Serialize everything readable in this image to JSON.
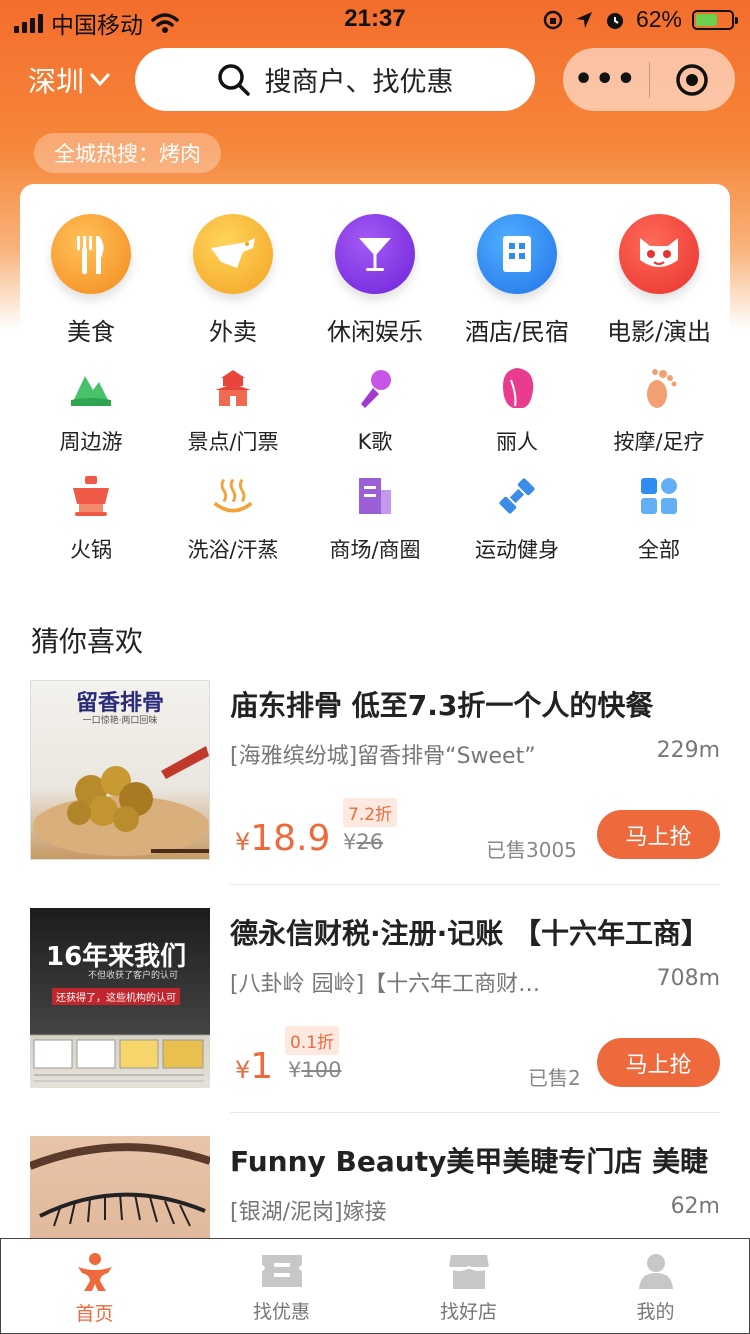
{
  "status_bar": {
    "carrier": "中国移动",
    "time": "21:37",
    "battery": "62%"
  },
  "header": {
    "city": "深圳",
    "search_placeholder": "搜商户、找优惠",
    "hot_search": "全城热搜：烤肉"
  },
  "primary_categories": [
    {
      "label": "美食",
      "icon": "cutlery-icon",
      "color": "#f7a22a"
    },
    {
      "label": "外卖",
      "icon": "kangaroo-icon",
      "color": "#f8b42a"
    },
    {
      "label": "休闲娱乐",
      "icon": "cocktail-icon",
      "color": "#8a33e6"
    },
    {
      "label": "酒店/民宿",
      "icon": "building-icon",
      "color": "#2d8df0"
    },
    {
      "label": "电影/演出",
      "icon": "cat-icon",
      "color": "#f2483f"
    }
  ],
  "secondary_categories": [
    {
      "label": "周边游",
      "icon": "mountain-icon"
    },
    {
      "label": "景点/门票",
      "icon": "temple-icon"
    },
    {
      "label": "K歌",
      "icon": "microphone-icon"
    },
    {
      "label": "丽人",
      "icon": "woman-icon"
    },
    {
      "label": "按摩/足疗",
      "icon": "footprint-icon"
    },
    {
      "label": "火锅",
      "icon": "hotpot-icon"
    },
    {
      "label": "洗浴/汗蒸",
      "icon": "hot-spring-icon"
    },
    {
      "label": "商场/商圈",
      "icon": "mall-icon"
    },
    {
      "label": "运动健身",
      "icon": "dumbbell-icon"
    },
    {
      "label": "全部",
      "icon": "grid-icon"
    }
  ],
  "section_title": "猜你喜欢",
  "deals": [
    {
      "title": "庙东排骨 低至7.3折一个人的快餐",
      "subtitle": "[海雅缤纷城]留香排骨“Sweet”",
      "distance": "229m",
      "discount": "7.2折",
      "price": "18.9",
      "original_price": "26",
      "sold": "已售3005",
      "button": "马上抢",
      "thumb_text": "留香排骨",
      "thumb_sub": "一口惊艳·两口回味"
    },
    {
      "title": "德永信财税·注册·记账 【十六年工商】",
      "subtitle": "[八卦岭 园岭]【十六年工商财税】",
      "distance": "708m",
      "discount": "0.1折",
      "price": "1",
      "original_price": "100",
      "sold": "已售2",
      "button": "马上抢",
      "thumb_text": "16年来我们",
      "thumb_sub": "不但收获了客户的认可",
      "thumb_banner": "还获得了，这些机构的认可"
    },
    {
      "title": "Funny Beauty美甲美睫专门店 美睫",
      "subtitle": "[银湖/泥岗]嫁接",
      "distance": "62m"
    }
  ],
  "currency": "¥",
  "tabs": [
    {
      "label": "首页",
      "icon": "home-person-icon",
      "active": true
    },
    {
      "label": "找优惠",
      "icon": "coupon-icon",
      "active": false
    },
    {
      "label": "找好店",
      "icon": "shop-icon",
      "active": false
    },
    {
      "label": "我的",
      "icon": "user-icon",
      "active": false
    }
  ]
}
